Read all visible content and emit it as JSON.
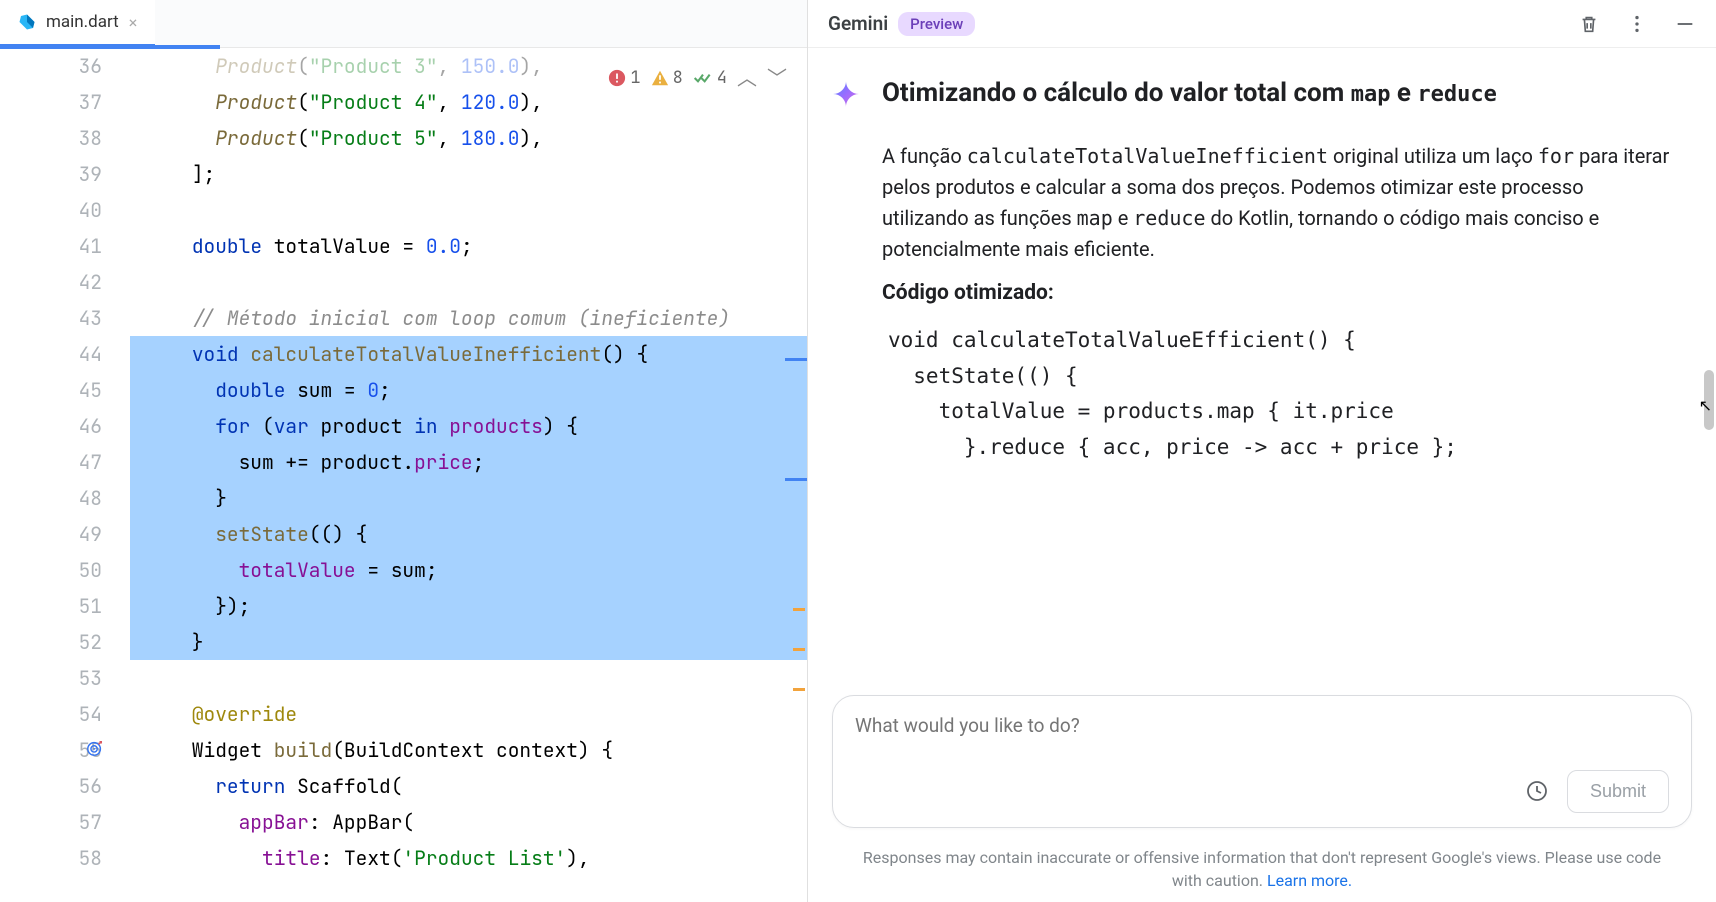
{
  "tab": {
    "filename": "main.dart"
  },
  "problems": {
    "errors": "1",
    "warnings": "8",
    "checks": "4"
  },
  "gutter_start": 36,
  "code_lines": [
    {
      "n": 36,
      "tokens": [
        [
          "      ",
          ""
        ],
        [
          "Product",
          "call"
        ],
        [
          "(",
          ""
        ],
        [
          "\"Product 3\"",
          "str"
        ],
        [
          ", ",
          ""
        ],
        [
          "150.0",
          "num"
        ],
        [
          "),",
          ""
        ]
      ],
      "faded": true
    },
    {
      "n": 37,
      "tokens": [
        [
          "      ",
          ""
        ],
        [
          "Product",
          "call"
        ],
        [
          "(",
          ""
        ],
        [
          "\"Product 4\"",
          "str"
        ],
        [
          ", ",
          ""
        ],
        [
          "120.0",
          "num"
        ],
        [
          "),",
          ""
        ]
      ]
    },
    {
      "n": 38,
      "tokens": [
        [
          "      ",
          ""
        ],
        [
          "Product",
          "call"
        ],
        [
          "(",
          ""
        ],
        [
          "\"Product 5\"",
          "str"
        ],
        [
          ", ",
          ""
        ],
        [
          "180.0",
          "num"
        ],
        [
          "),",
          ""
        ]
      ]
    },
    {
      "n": 39,
      "tokens": [
        [
          "    ];",
          ""
        ]
      ]
    },
    {
      "n": 40,
      "tokens": [
        [
          "",
          ""
        ]
      ]
    },
    {
      "n": 41,
      "tokens": [
        [
          "    ",
          ""
        ],
        [
          "double",
          "kw"
        ],
        [
          " totalValue = ",
          ""
        ],
        [
          "0.0",
          "num"
        ],
        [
          ";",
          ""
        ]
      ]
    },
    {
      "n": 42,
      "tokens": [
        [
          "",
          ""
        ]
      ]
    },
    {
      "n": 43,
      "tokens": [
        [
          "    ",
          ""
        ],
        [
          "// Método inicial com loop comum (ineficiente)",
          "comment"
        ]
      ]
    },
    {
      "n": 44,
      "sel": true,
      "tokens": [
        [
          "    ",
          ""
        ],
        [
          "void",
          "kw"
        ],
        [
          " ",
          ""
        ],
        [
          "calculateTotalValueInefficient",
          "method"
        ],
        [
          "() {",
          ""
        ]
      ]
    },
    {
      "n": 45,
      "sel": true,
      "tokens": [
        [
          "      ",
          ""
        ],
        [
          "double",
          "kw"
        ],
        [
          " sum = ",
          ""
        ],
        [
          "0",
          "num"
        ],
        [
          ";",
          ""
        ]
      ]
    },
    {
      "n": 46,
      "sel": true,
      "tokens": [
        [
          "      ",
          ""
        ],
        [
          "for",
          "kw"
        ],
        [
          " (",
          ""
        ],
        [
          "var",
          "kw"
        ],
        [
          " product ",
          ""
        ],
        [
          "in",
          "kw"
        ],
        [
          " ",
          ""
        ],
        [
          "products",
          "field"
        ],
        [
          ") {",
          ""
        ]
      ]
    },
    {
      "n": 47,
      "sel": true,
      "tokens": [
        [
          "        sum += product.",
          ""
        ],
        [
          "price",
          "member"
        ],
        [
          ";",
          ""
        ]
      ]
    },
    {
      "n": 48,
      "sel": true,
      "tokens": [
        [
          "      }",
          ""
        ]
      ]
    },
    {
      "n": 49,
      "sel": true,
      "tokens": [
        [
          "      ",
          ""
        ],
        [
          "setState",
          "method"
        ],
        [
          "(() {",
          ""
        ]
      ]
    },
    {
      "n": 50,
      "sel": true,
      "tokens": [
        [
          "        ",
          ""
        ],
        [
          "totalValue",
          "field"
        ],
        [
          " = sum;",
          ""
        ]
      ]
    },
    {
      "n": 51,
      "sel": true,
      "tokens": [
        [
          "      });",
          ""
        ]
      ]
    },
    {
      "n": 52,
      "sel": true,
      "tokens": [
        [
          "    }",
          ""
        ]
      ]
    },
    {
      "n": 53,
      "tokens": [
        [
          "",
          ""
        ]
      ]
    },
    {
      "n": 54,
      "tokens": [
        [
          "    ",
          ""
        ],
        [
          "@override",
          "ann"
        ]
      ]
    },
    {
      "n": 55,
      "glyph": "target",
      "tokens": [
        [
          "    Widget ",
          ""
        ],
        [
          "build",
          "method"
        ],
        [
          "(BuildContext context) {",
          ""
        ]
      ]
    },
    {
      "n": 56,
      "tokens": [
        [
          "      ",
          ""
        ],
        [
          "return",
          "kw"
        ],
        [
          " ",
          ""
        ],
        [
          "Scaffold",
          "type"
        ],
        [
          "(",
          ""
        ]
      ]
    },
    {
      "n": 57,
      "tokens": [
        [
          "        ",
          ""
        ],
        [
          "appBar",
          "field"
        ],
        [
          ": ",
          ""
        ],
        [
          "AppBar",
          "type"
        ],
        [
          "(",
          ""
        ]
      ]
    },
    {
      "n": 58,
      "tokens": [
        [
          "          ",
          ""
        ],
        [
          "title",
          "field"
        ],
        [
          ": ",
          ""
        ],
        [
          "Text",
          "type"
        ],
        [
          "(",
          ""
        ],
        [
          "'Product List'",
          "str"
        ],
        [
          "),",
          ""
        ]
      ]
    }
  ],
  "gemini": {
    "label": "Gemini",
    "badge": "Preview",
    "heading_pre": "Otimizando o cálculo do valor total com ",
    "heading_m1": "map",
    "heading_mid": " e ",
    "heading_m2": "reduce",
    "para_1a": "A função ",
    "para_1b": "calculateTotalValueInefficient",
    "para_1c": " original utiliza um laço ",
    "para_1d": "for",
    "para_1e": " para iterar pelos produtos e calcular a soma dos preços. Podemos otimizar este processo utilizando as funções ",
    "para_1f": "map",
    "para_1g": " e ",
    "para_1h": "reduce",
    "para_1i": " do Kotlin, tornando o código mais conciso e potencialmente mais eficiente.",
    "subhead": "Código otimizado:",
    "code": "void calculateTotalValueEfficient() {\n  setState(() {\n    totalValue = products.map { it.price\n      }.reduce { acc, price -> acc + price };"
  },
  "input": {
    "placeholder": "What would you like to do?",
    "submit": "Submit"
  },
  "disclaimer": {
    "text": "Responses may contain inaccurate or offensive information that don't represent Google's views. Please use code with caution. ",
    "link": "Learn more."
  }
}
